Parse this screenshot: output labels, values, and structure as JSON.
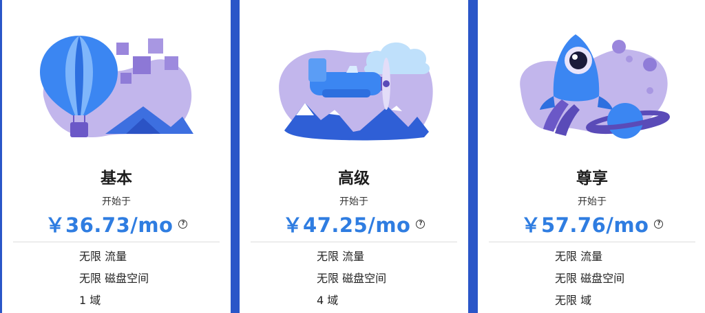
{
  "colors": {
    "accent_price": "#2f7de1",
    "page_stripe": "#2a56c8",
    "blob_purple": "#b7a9e6",
    "illustration_blue": "#3d7ff0"
  },
  "plans": [
    {
      "illustration_icon": "hot-air-balloon-icon",
      "name": "基本",
      "starting_label": "开始于",
      "price": "￥36.73/mo",
      "help_glyph": "?",
      "features": [
        "无限 流量",
        "无限 磁盘空间",
        "1 域"
      ]
    },
    {
      "illustration_icon": "airplane-icon",
      "name": "高级",
      "starting_label": "开始于",
      "price": "￥47.25/mo",
      "help_glyph": "?",
      "features": [
        "无限 流量",
        "无限 磁盘空间",
        "4 域"
      ]
    },
    {
      "illustration_icon": "rocket-icon",
      "name": "尊享",
      "starting_label": "开始于",
      "price": "￥57.76/mo",
      "help_glyph": "?",
      "features": [
        "无限 流量",
        "无限 磁盘空间",
        "无限 域"
      ]
    }
  ]
}
